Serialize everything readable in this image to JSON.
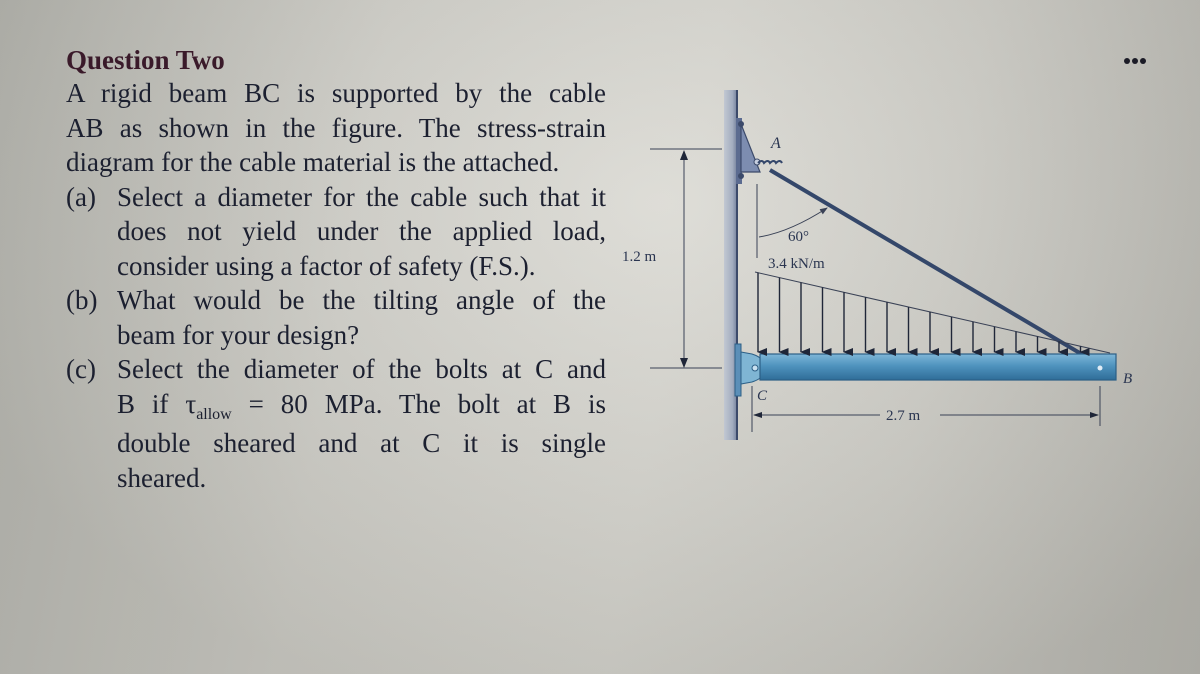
{
  "question": {
    "title": "Question Two",
    "intro_lines": [
      "A rigid beam BC is supported by the cable",
      "AB as shown in the figure. The stress-strain",
      "diagram for the cable material is the attached."
    ],
    "part_a": {
      "label": "(a)",
      "lines": [
        "Select a diameter for the cable such that it",
        "does not yield under the applied load,",
        "consider using a factor of safety (F.S.)."
      ]
    },
    "part_b": {
      "label": "(b)",
      "lines": [
        "What would be the tilting angle of the",
        "beam for your design?"
      ]
    },
    "part_c": {
      "label": "(c)",
      "line1": "Select the diameter of the bolts at C and",
      "line2_prefix": "B if ",
      "tau_symbol": "τ",
      "tau_subscript": "allow",
      "line2_suffix": " = 80 MPa. The bolt at B is",
      "lines_rest": [
        "double sheared and at C it is single",
        "sheared."
      ]
    }
  },
  "figure": {
    "point_a_label": "A",
    "point_b_label": "B",
    "point_c_label": "C",
    "angle_label": "60°",
    "load_label": "3.4 kN/m",
    "height_label": "1.2 m",
    "length_label": "2.7 m",
    "colors": {
      "beam": "#4f93be",
      "beam_dark": "#2c5f86",
      "wall": "#9aa6bd",
      "bracket": "#7d8db0",
      "cable": "#34476a",
      "arrow": "#1f2638"
    }
  },
  "menu": {
    "icon": "more-options-icon"
  }
}
